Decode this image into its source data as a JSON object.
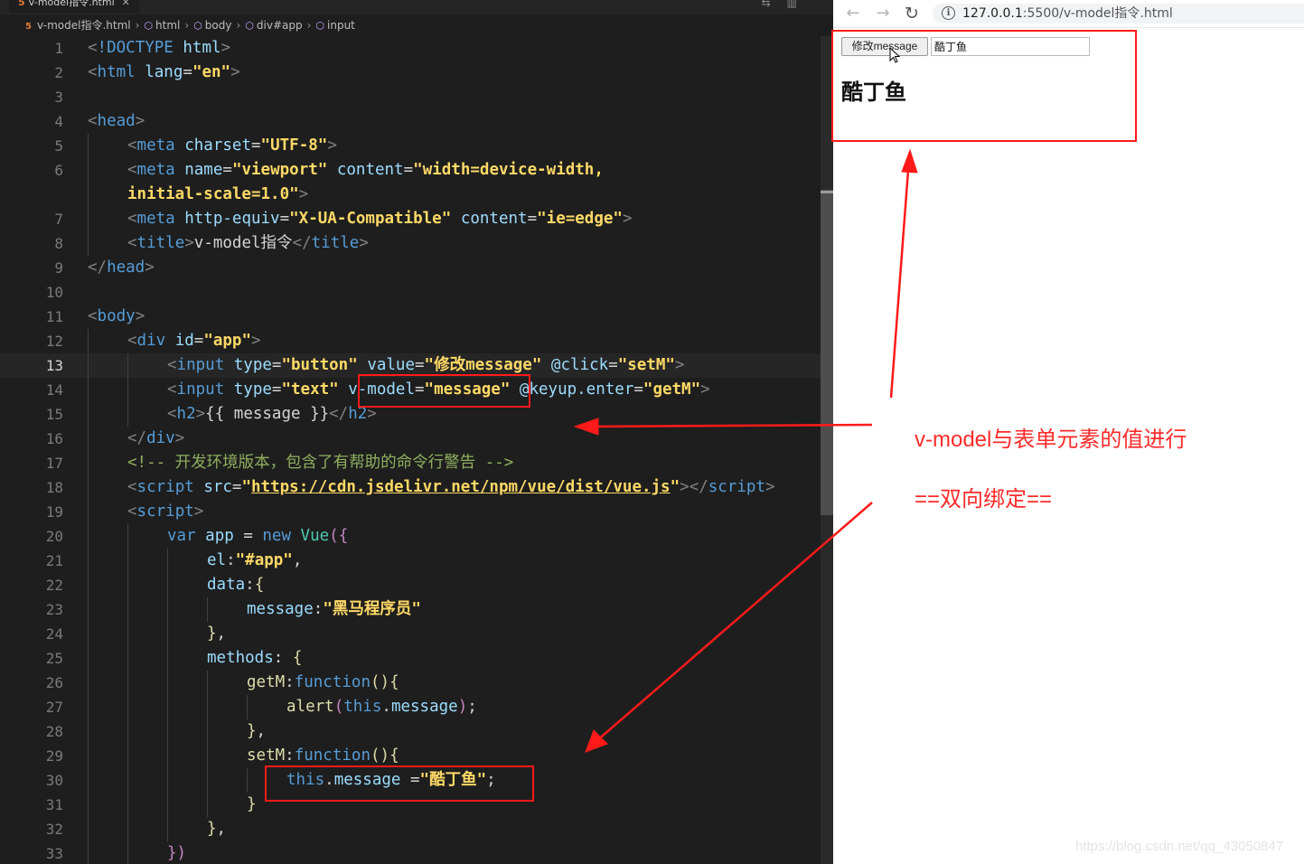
{
  "editor": {
    "tab_title": "v-model指令.html",
    "breadcrumb": [
      "v-model指令.html",
      "html",
      "body",
      "div#app",
      "input"
    ],
    "current_line": 13,
    "lines": [
      {
        "n": "1",
        "ind": 0,
        "t": [
          [
            "tk-br",
            "<"
          ],
          [
            "tk-tag",
            "!DOCTYPE "
          ],
          [
            "tk-attr",
            "html"
          ],
          [
            "tk-br",
            ">"
          ]
        ]
      },
      {
        "n": "2",
        "ind": 0,
        "t": [
          [
            "tk-br",
            "<"
          ],
          [
            "tk-tag",
            "html "
          ],
          [
            "tk-attr",
            "lang"
          ],
          [
            "tk-txt",
            "="
          ],
          [
            "tk-str",
            "\"en\""
          ],
          [
            "tk-br",
            ">"
          ]
        ]
      },
      {
        "n": "3",
        "ind": 0,
        "t": []
      },
      {
        "n": "4",
        "ind": 0,
        "t": [
          [
            "tk-br",
            "<"
          ],
          [
            "tk-tag",
            "head"
          ],
          [
            "tk-br",
            ">"
          ]
        ]
      },
      {
        "n": "5",
        "ind": 1,
        "t": [
          [
            "tk-br",
            "<"
          ],
          [
            "tk-tag",
            "meta "
          ],
          [
            "tk-attr",
            "charset"
          ],
          [
            "tk-txt",
            "="
          ],
          [
            "tk-str",
            "\"UTF-8\""
          ],
          [
            "tk-br",
            ">"
          ]
        ]
      },
      {
        "n": "6",
        "ind": 1,
        "t": [
          [
            "tk-br",
            "<"
          ],
          [
            "tk-tag",
            "meta "
          ],
          [
            "tk-attr",
            "name"
          ],
          [
            "tk-txt",
            "="
          ],
          [
            "tk-str",
            "\"viewport\""
          ],
          [
            "tk-txt",
            " "
          ],
          [
            "tk-attr",
            "content"
          ],
          [
            "tk-txt",
            "="
          ],
          [
            "tk-str",
            "\"width=device-width,"
          ]
        ]
      },
      {
        "n": "",
        "ind": 1,
        "t": [
          [
            "tk-str",
            "initial-scale=1.0\""
          ],
          [
            "tk-br",
            ">"
          ]
        ]
      },
      {
        "n": "7",
        "ind": 1,
        "t": [
          [
            "tk-br",
            "<"
          ],
          [
            "tk-tag",
            "meta "
          ],
          [
            "tk-attr",
            "http-equiv"
          ],
          [
            "tk-txt",
            "="
          ],
          [
            "tk-str",
            "\"X-UA-Compatible\""
          ],
          [
            "tk-txt",
            " "
          ],
          [
            "tk-attr",
            "content"
          ],
          [
            "tk-txt",
            "="
          ],
          [
            "tk-str",
            "\"ie=edge\""
          ],
          [
            "tk-br",
            ">"
          ]
        ]
      },
      {
        "n": "8",
        "ind": 1,
        "t": [
          [
            "tk-br",
            "<"
          ],
          [
            "tk-tag",
            "title"
          ],
          [
            "tk-br",
            ">"
          ],
          [
            "tk-txt",
            "v-model指令"
          ],
          [
            "tk-br",
            "</"
          ],
          [
            "tk-tag",
            "title"
          ],
          [
            "tk-br",
            ">"
          ]
        ]
      },
      {
        "n": "9",
        "ind": 0,
        "t": [
          [
            "tk-br",
            "</"
          ],
          [
            "tk-tag",
            "head"
          ],
          [
            "tk-br",
            ">"
          ]
        ]
      },
      {
        "n": "10",
        "ind": 0,
        "t": []
      },
      {
        "n": "11",
        "ind": 0,
        "t": [
          [
            "tk-br",
            "<"
          ],
          [
            "tk-tag",
            "body"
          ],
          [
            "tk-br",
            ">"
          ]
        ]
      },
      {
        "n": "12",
        "ind": 1,
        "t": [
          [
            "tk-br",
            "<"
          ],
          [
            "tk-tag",
            "div "
          ],
          [
            "tk-attr",
            "id"
          ],
          [
            "tk-txt",
            "="
          ],
          [
            "tk-str",
            "\"app\""
          ],
          [
            "tk-br",
            ">"
          ]
        ]
      },
      {
        "n": "13",
        "ind": 2,
        "t": [
          [
            "tk-br",
            "<"
          ],
          [
            "tk-tag",
            "input "
          ],
          [
            "tk-attr",
            "type"
          ],
          [
            "tk-txt",
            "="
          ],
          [
            "tk-str",
            "\"button\""
          ],
          [
            "tk-txt",
            " "
          ],
          [
            "tk-attr",
            "value"
          ],
          [
            "tk-txt",
            "="
          ],
          [
            "tk-str",
            "\"修改message\""
          ],
          [
            "tk-txt",
            " "
          ],
          [
            "tk-attr",
            "@click"
          ],
          [
            "tk-txt",
            "="
          ],
          [
            "tk-str",
            "\"setM\""
          ],
          [
            "tk-br",
            ">"
          ]
        ]
      },
      {
        "n": "14",
        "ind": 2,
        "t": [
          [
            "tk-br",
            "<"
          ],
          [
            "tk-tag",
            "input "
          ],
          [
            "tk-attr",
            "type"
          ],
          [
            "tk-txt",
            "="
          ],
          [
            "tk-str",
            "\"text\""
          ],
          [
            "tk-txt",
            " "
          ],
          [
            "tk-attr",
            "v-model"
          ],
          [
            "tk-txt",
            "="
          ],
          [
            "tk-str",
            "\"message\""
          ],
          [
            "tk-txt",
            " "
          ],
          [
            "tk-attr",
            "@keyup.enter"
          ],
          [
            "tk-txt",
            "="
          ],
          [
            "tk-str",
            "\"getM\""
          ],
          [
            "tk-br",
            ">"
          ]
        ]
      },
      {
        "n": "15",
        "ind": 2,
        "t": [
          [
            "tk-br",
            "<"
          ],
          [
            "tk-tag",
            "h2"
          ],
          [
            "tk-br",
            ">"
          ],
          [
            "tk-txt",
            "{{ message }}"
          ],
          [
            "tk-br",
            "</"
          ],
          [
            "tk-tag",
            "h2"
          ],
          [
            "tk-br",
            ">"
          ]
        ]
      },
      {
        "n": "16",
        "ind": 1,
        "t": [
          [
            "tk-br",
            "</"
          ],
          [
            "tk-tag",
            "div"
          ],
          [
            "tk-br",
            ">"
          ]
        ]
      },
      {
        "n": "17",
        "ind": 1,
        "t": [
          [
            "tk-cm",
            "<!-- 开发环境版本，包含了有帮助的命令行警告 -->"
          ]
        ]
      },
      {
        "n": "18",
        "ind": 1,
        "t": [
          [
            "tk-br",
            "<"
          ],
          [
            "tk-tag",
            "script "
          ],
          [
            "tk-attr",
            "src"
          ],
          [
            "tk-txt",
            "="
          ],
          [
            "tk-str",
            "\""
          ],
          [
            "tk-link",
            "https://cdn.jsdelivr.net/npm/vue/dist/vue.js"
          ],
          [
            "tk-str",
            "\""
          ],
          [
            "tk-br",
            "></"
          ],
          [
            "tk-tag",
            "script"
          ],
          [
            "tk-br",
            ">"
          ]
        ]
      },
      {
        "n": "19",
        "ind": 1,
        "t": [
          [
            "tk-br",
            "<"
          ],
          [
            "tk-tag",
            "script"
          ],
          [
            "tk-br",
            ">"
          ]
        ]
      },
      {
        "n": "20",
        "ind": 2,
        "t": [
          [
            "tk-kw",
            "var "
          ],
          [
            "tk-var",
            "app "
          ],
          [
            "tk-txt",
            "= "
          ],
          [
            "tk-kw",
            "new "
          ],
          [
            "tk-cls",
            "Vue"
          ],
          [
            "tk-purple",
            "({"
          ]
        ]
      },
      {
        "n": "21",
        "ind": 3,
        "t": [
          [
            "tk-var",
            "el"
          ],
          [
            "tk-txt",
            ":"
          ],
          [
            "tk-str",
            "\"#app\""
          ],
          [
            "tk-txt",
            ","
          ]
        ]
      },
      {
        "n": "22",
        "ind": 3,
        "t": [
          [
            "tk-var",
            "data"
          ],
          [
            "tk-txt",
            ":"
          ],
          [
            "tk-fn",
            "{"
          ]
        ]
      },
      {
        "n": "23",
        "ind": 4,
        "t": [
          [
            "tk-var",
            "message"
          ],
          [
            "tk-txt",
            ":"
          ],
          [
            "tk-str",
            "\"黑马程序员\""
          ]
        ]
      },
      {
        "n": "24",
        "ind": 3,
        "t": [
          [
            "tk-fn",
            "}"
          ],
          [
            "tk-txt",
            ","
          ]
        ]
      },
      {
        "n": "25",
        "ind": 3,
        "t": [
          [
            "tk-var",
            "methods"
          ],
          [
            "tk-txt",
            ": "
          ],
          [
            "tk-fn",
            "{"
          ]
        ]
      },
      {
        "n": "26",
        "ind": 4,
        "t": [
          [
            "tk-fn",
            "getM"
          ],
          [
            "tk-txt",
            ":"
          ],
          [
            "tk-kw",
            "function"
          ],
          [
            "tk-fn",
            "(){"
          ]
        ]
      },
      {
        "n": "27",
        "ind": 5,
        "t": [
          [
            "tk-fn",
            "alert"
          ],
          [
            "tk-purple",
            "("
          ],
          [
            "tk-kw",
            "this"
          ],
          [
            "tk-txt",
            "."
          ],
          [
            "tk-var",
            "message"
          ],
          [
            "tk-purple",
            ")"
          ],
          [
            "tk-txt",
            ";"
          ]
        ]
      },
      {
        "n": "28",
        "ind": 4,
        "t": [
          [
            "tk-fn",
            "}"
          ],
          [
            "tk-txt",
            ","
          ]
        ]
      },
      {
        "n": "29",
        "ind": 4,
        "t": [
          [
            "tk-fn",
            "setM"
          ],
          [
            "tk-txt",
            ":"
          ],
          [
            "tk-kw",
            "function"
          ],
          [
            "tk-fn",
            "(){"
          ]
        ]
      },
      {
        "n": "30",
        "ind": 5,
        "t": [
          [
            "tk-kw",
            "this"
          ],
          [
            "tk-txt",
            "."
          ],
          [
            "tk-var",
            "message "
          ],
          [
            "tk-txt",
            "="
          ],
          [
            "tk-str",
            "\"酷丁鱼\""
          ],
          [
            "tk-txt",
            ";"
          ]
        ]
      },
      {
        "n": "31",
        "ind": 4,
        "t": [
          [
            "tk-fn",
            "}"
          ]
        ]
      },
      {
        "n": "32",
        "ind": 3,
        "t": [
          [
            "tk-fn",
            "}"
          ],
          [
            "tk-txt",
            ","
          ]
        ]
      },
      {
        "n": "33",
        "ind": 2,
        "t": [
          [
            "tk-purple",
            "})"
          ]
        ]
      }
    ]
  },
  "browser": {
    "url_host": "127.0.0.1",
    "url_rest": ":5500/v-model指令.html",
    "button_value": "修改message",
    "input_value": "酷丁鱼",
    "heading": "酷丁鱼"
  },
  "annotation": {
    "note1": "v-model与表单元素的值进行",
    "note2": "==双向绑定==",
    "color": "#ff1a1a"
  },
  "watermark": "https://blog.csdn.net/qq_43050847"
}
